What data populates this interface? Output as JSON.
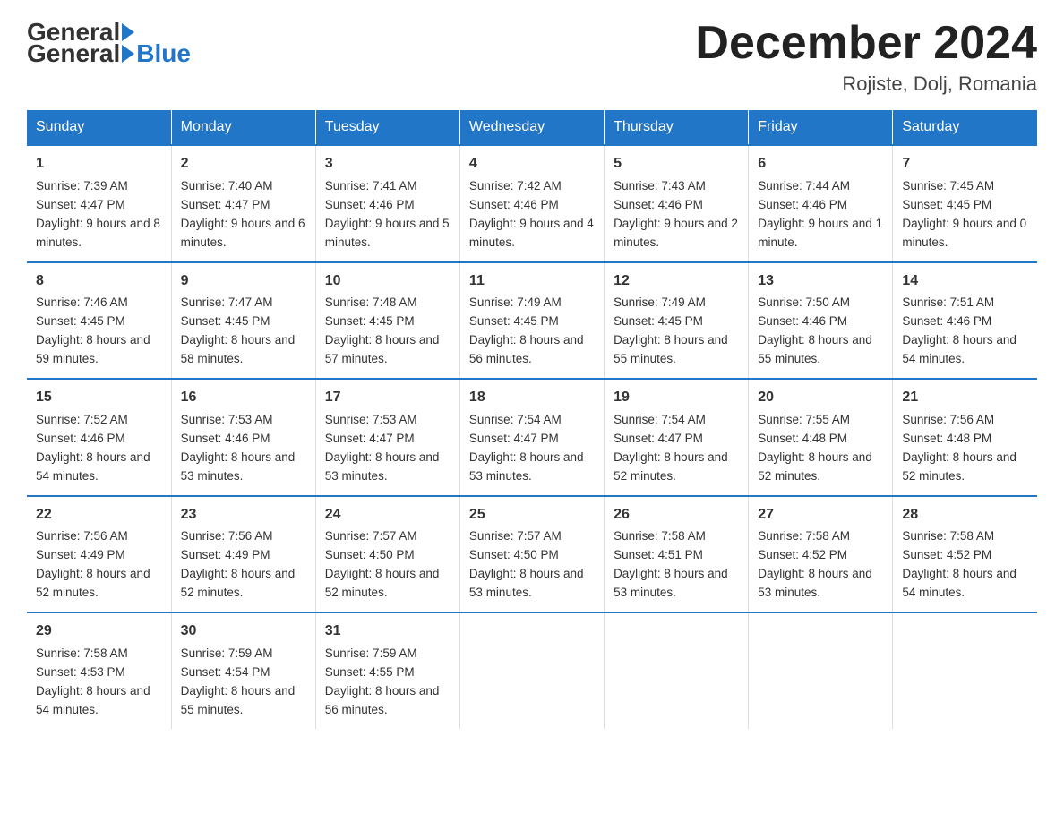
{
  "header": {
    "logo_general": "General",
    "logo_blue": "Blue",
    "month_title": "December 2024",
    "location": "Rojiste, Dolj, Romania"
  },
  "weekdays": [
    "Sunday",
    "Monday",
    "Tuesday",
    "Wednesday",
    "Thursday",
    "Friday",
    "Saturday"
  ],
  "weeks": [
    [
      {
        "day": "1",
        "sunrise": "Sunrise: 7:39 AM",
        "sunset": "Sunset: 4:47 PM",
        "daylight": "Daylight: 9 hours and 8 minutes."
      },
      {
        "day": "2",
        "sunrise": "Sunrise: 7:40 AM",
        "sunset": "Sunset: 4:47 PM",
        "daylight": "Daylight: 9 hours and 6 minutes."
      },
      {
        "day": "3",
        "sunrise": "Sunrise: 7:41 AM",
        "sunset": "Sunset: 4:46 PM",
        "daylight": "Daylight: 9 hours and 5 minutes."
      },
      {
        "day": "4",
        "sunrise": "Sunrise: 7:42 AM",
        "sunset": "Sunset: 4:46 PM",
        "daylight": "Daylight: 9 hours and 4 minutes."
      },
      {
        "day": "5",
        "sunrise": "Sunrise: 7:43 AM",
        "sunset": "Sunset: 4:46 PM",
        "daylight": "Daylight: 9 hours and 2 minutes."
      },
      {
        "day": "6",
        "sunrise": "Sunrise: 7:44 AM",
        "sunset": "Sunset: 4:46 PM",
        "daylight": "Daylight: 9 hours and 1 minute."
      },
      {
        "day": "7",
        "sunrise": "Sunrise: 7:45 AM",
        "sunset": "Sunset: 4:45 PM",
        "daylight": "Daylight: 9 hours and 0 minutes."
      }
    ],
    [
      {
        "day": "8",
        "sunrise": "Sunrise: 7:46 AM",
        "sunset": "Sunset: 4:45 PM",
        "daylight": "Daylight: 8 hours and 59 minutes."
      },
      {
        "day": "9",
        "sunrise": "Sunrise: 7:47 AM",
        "sunset": "Sunset: 4:45 PM",
        "daylight": "Daylight: 8 hours and 58 minutes."
      },
      {
        "day": "10",
        "sunrise": "Sunrise: 7:48 AM",
        "sunset": "Sunset: 4:45 PM",
        "daylight": "Daylight: 8 hours and 57 minutes."
      },
      {
        "day": "11",
        "sunrise": "Sunrise: 7:49 AM",
        "sunset": "Sunset: 4:45 PM",
        "daylight": "Daylight: 8 hours and 56 minutes."
      },
      {
        "day": "12",
        "sunrise": "Sunrise: 7:49 AM",
        "sunset": "Sunset: 4:45 PM",
        "daylight": "Daylight: 8 hours and 55 minutes."
      },
      {
        "day": "13",
        "sunrise": "Sunrise: 7:50 AM",
        "sunset": "Sunset: 4:46 PM",
        "daylight": "Daylight: 8 hours and 55 minutes."
      },
      {
        "day": "14",
        "sunrise": "Sunrise: 7:51 AM",
        "sunset": "Sunset: 4:46 PM",
        "daylight": "Daylight: 8 hours and 54 minutes."
      }
    ],
    [
      {
        "day": "15",
        "sunrise": "Sunrise: 7:52 AM",
        "sunset": "Sunset: 4:46 PM",
        "daylight": "Daylight: 8 hours and 54 minutes."
      },
      {
        "day": "16",
        "sunrise": "Sunrise: 7:53 AM",
        "sunset": "Sunset: 4:46 PM",
        "daylight": "Daylight: 8 hours and 53 minutes."
      },
      {
        "day": "17",
        "sunrise": "Sunrise: 7:53 AM",
        "sunset": "Sunset: 4:47 PM",
        "daylight": "Daylight: 8 hours and 53 minutes."
      },
      {
        "day": "18",
        "sunrise": "Sunrise: 7:54 AM",
        "sunset": "Sunset: 4:47 PM",
        "daylight": "Daylight: 8 hours and 53 minutes."
      },
      {
        "day": "19",
        "sunrise": "Sunrise: 7:54 AM",
        "sunset": "Sunset: 4:47 PM",
        "daylight": "Daylight: 8 hours and 52 minutes."
      },
      {
        "day": "20",
        "sunrise": "Sunrise: 7:55 AM",
        "sunset": "Sunset: 4:48 PM",
        "daylight": "Daylight: 8 hours and 52 minutes."
      },
      {
        "day": "21",
        "sunrise": "Sunrise: 7:56 AM",
        "sunset": "Sunset: 4:48 PM",
        "daylight": "Daylight: 8 hours and 52 minutes."
      }
    ],
    [
      {
        "day": "22",
        "sunrise": "Sunrise: 7:56 AM",
        "sunset": "Sunset: 4:49 PM",
        "daylight": "Daylight: 8 hours and 52 minutes."
      },
      {
        "day": "23",
        "sunrise": "Sunrise: 7:56 AM",
        "sunset": "Sunset: 4:49 PM",
        "daylight": "Daylight: 8 hours and 52 minutes."
      },
      {
        "day": "24",
        "sunrise": "Sunrise: 7:57 AM",
        "sunset": "Sunset: 4:50 PM",
        "daylight": "Daylight: 8 hours and 52 minutes."
      },
      {
        "day": "25",
        "sunrise": "Sunrise: 7:57 AM",
        "sunset": "Sunset: 4:50 PM",
        "daylight": "Daylight: 8 hours and 53 minutes."
      },
      {
        "day": "26",
        "sunrise": "Sunrise: 7:58 AM",
        "sunset": "Sunset: 4:51 PM",
        "daylight": "Daylight: 8 hours and 53 minutes."
      },
      {
        "day": "27",
        "sunrise": "Sunrise: 7:58 AM",
        "sunset": "Sunset: 4:52 PM",
        "daylight": "Daylight: 8 hours and 53 minutes."
      },
      {
        "day": "28",
        "sunrise": "Sunrise: 7:58 AM",
        "sunset": "Sunset: 4:52 PM",
        "daylight": "Daylight: 8 hours and 54 minutes."
      }
    ],
    [
      {
        "day": "29",
        "sunrise": "Sunrise: 7:58 AM",
        "sunset": "Sunset: 4:53 PM",
        "daylight": "Daylight: 8 hours and 54 minutes."
      },
      {
        "day": "30",
        "sunrise": "Sunrise: 7:59 AM",
        "sunset": "Sunset: 4:54 PM",
        "daylight": "Daylight: 8 hours and 55 minutes."
      },
      {
        "day": "31",
        "sunrise": "Sunrise: 7:59 AM",
        "sunset": "Sunset: 4:55 PM",
        "daylight": "Daylight: 8 hours and 56 minutes."
      },
      {
        "day": "",
        "sunrise": "",
        "sunset": "",
        "daylight": ""
      },
      {
        "day": "",
        "sunrise": "",
        "sunset": "",
        "daylight": ""
      },
      {
        "day": "",
        "sunrise": "",
        "sunset": "",
        "daylight": ""
      },
      {
        "day": "",
        "sunrise": "",
        "sunset": "",
        "daylight": ""
      }
    ]
  ]
}
